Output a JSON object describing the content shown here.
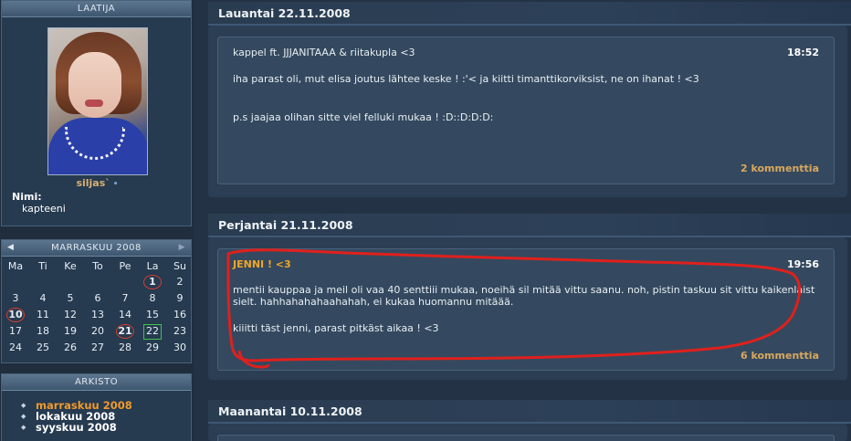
{
  "sidebar": {
    "profile": {
      "header": "LAATIJA",
      "username": "siljas`",
      "username_dot": "•",
      "field_label": "Nimi:",
      "field_value": "kapteeni"
    },
    "calendar": {
      "month_title": "MARRASKUU 2008",
      "prev_arrow": "◀",
      "next_arrow": "▶",
      "weekdays": [
        "Ma",
        "Ti",
        "Ke",
        "To",
        "Pe",
        "La",
        "Su"
      ],
      "weeks": [
        [
          "",
          "",
          "",
          "",
          "",
          "1",
          "2"
        ],
        [
          "3",
          "4",
          "5",
          "6",
          "7",
          "8",
          "9"
        ],
        [
          "10",
          "11",
          "12",
          "13",
          "14",
          "15",
          "16"
        ],
        [
          "17",
          "18",
          "19",
          "20",
          "21",
          "22",
          "23"
        ],
        [
          "24",
          "25",
          "26",
          "27",
          "28",
          "29",
          "30"
        ]
      ],
      "post_days": [
        "1",
        "10",
        "21"
      ],
      "today": "22"
    },
    "archive": {
      "header": "ARKISTO",
      "items": [
        {
          "label": "marraskuu 2008",
          "active": true
        },
        {
          "label": "lokakuu 2008",
          "active": false
        },
        {
          "label": "syyskuu 2008",
          "active": false
        }
      ]
    }
  },
  "main": {
    "days": [
      {
        "date_title": "Lauantai 22.11.2008",
        "post": {
          "title": "kappel ft. JJJANITAAA & riitakupla <3",
          "time": "18:52",
          "paragraphs": [
            "iha parast oli, mut elisa joutus lähtee keske ! :'< ja kiitti timanttikorviksist, ne on ihanat ! <3",
            "p.s jaajaa olihan sitte viel felluki mukaa ! :D::D:D:D:"
          ],
          "comments": "2 kommenttia"
        }
      },
      {
        "date_title": "Perjantai 21.11.2008",
        "post": {
          "title": "JENNI ! <3",
          "time": "19:56",
          "paragraphs": [
            "mentii kauppaa ja meil oli vaa 40 senttiii mukaa, noeihä sil mitää vittu saanu. noh, pistin taskuu sit vittu kaikenlaist sielt. hahhahahahaahahah, ei kukaa huomannu mitäää.",
            "kiiitti täst jenni, parast pitkäst aikaa ! <3"
          ],
          "comments": "6 kommenttia"
        }
      },
      {
        "date_title": "Maanantai 10.11.2008"
      }
    ]
  },
  "colors": {
    "background": "#233345",
    "accent_orange": "#f09a2a",
    "comment_gold": "#d9a85c",
    "annotation_red": "#e0201c",
    "today_green": "#3cc34a"
  }
}
